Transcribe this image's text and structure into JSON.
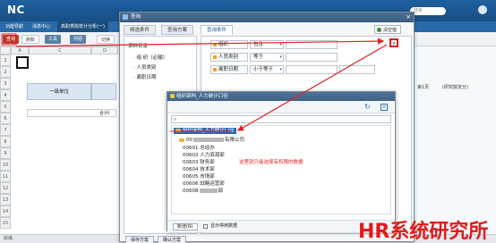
{
  "app": {
    "logo": "NC",
    "search_placeholder": "搜索"
  },
  "menu": {
    "items": [
      "功能导航",
      "消息中心",
      "高职类院校计分析(一)"
    ]
  },
  "toolbar": {
    "btn1": "查询",
    "btn2": "刷新",
    "btn3": "工具",
    "btn4": "列把",
    "btn5": "切换"
  },
  "sheet": {
    "cols": [
      "A",
      "C",
      "D"
    ],
    "rows": [
      "1",
      "2",
      "3",
      "4",
      "5",
      "6",
      "7",
      "8",
      "9",
      "10",
      "11",
      "12",
      "13",
      "14",
      "15"
    ],
    "header_cell": "一级单位",
    "sum_cell": "合计(",
    "page_label": "第1页",
    "info_label": "(研究院定分)"
  },
  "query_dialog": {
    "title": "查询",
    "tabs": [
      "候选条件",
      "查询方案",
      "查询条件"
    ],
    "clear_label": "清空值",
    "tree": [
      "资料目录",
      "· 组 织（必输）",
      "· 人员类别",
      "· 离职日期"
    ],
    "conditions": [
      {
        "label": "组织",
        "op": "包含"
      },
      {
        "label": "人员类别",
        "op": "等于"
      },
      {
        "label": "离职日期",
        "op": "小于等于"
      }
    ],
    "save_scheme": "保存方案",
    "btn2": "确认方案"
  },
  "org_dialog": {
    "title": "组织架构_人力统计口径",
    "root": "组织架构_人力统计口径",
    "node_prefix": "00",
    "node_suffix": "有限公司",
    "children": [
      "00601 总经办",
      "00602 人力资源部",
      "00603 财务部",
      "00604 技术部",
      "00605 市场部",
      "00606 战略运营部",
      "00608"
    ],
    "child_suffix": "部",
    "annotation": "这里就只能选择有权限的数据",
    "new_button": "新增(N)",
    "checkbox_label": "显示停用数据"
  },
  "statusbar": "就绪",
  "watermark": "HR系统研究所",
  "colors": {
    "accent": "#1f5f9e",
    "annotation_red": "#e02020"
  }
}
